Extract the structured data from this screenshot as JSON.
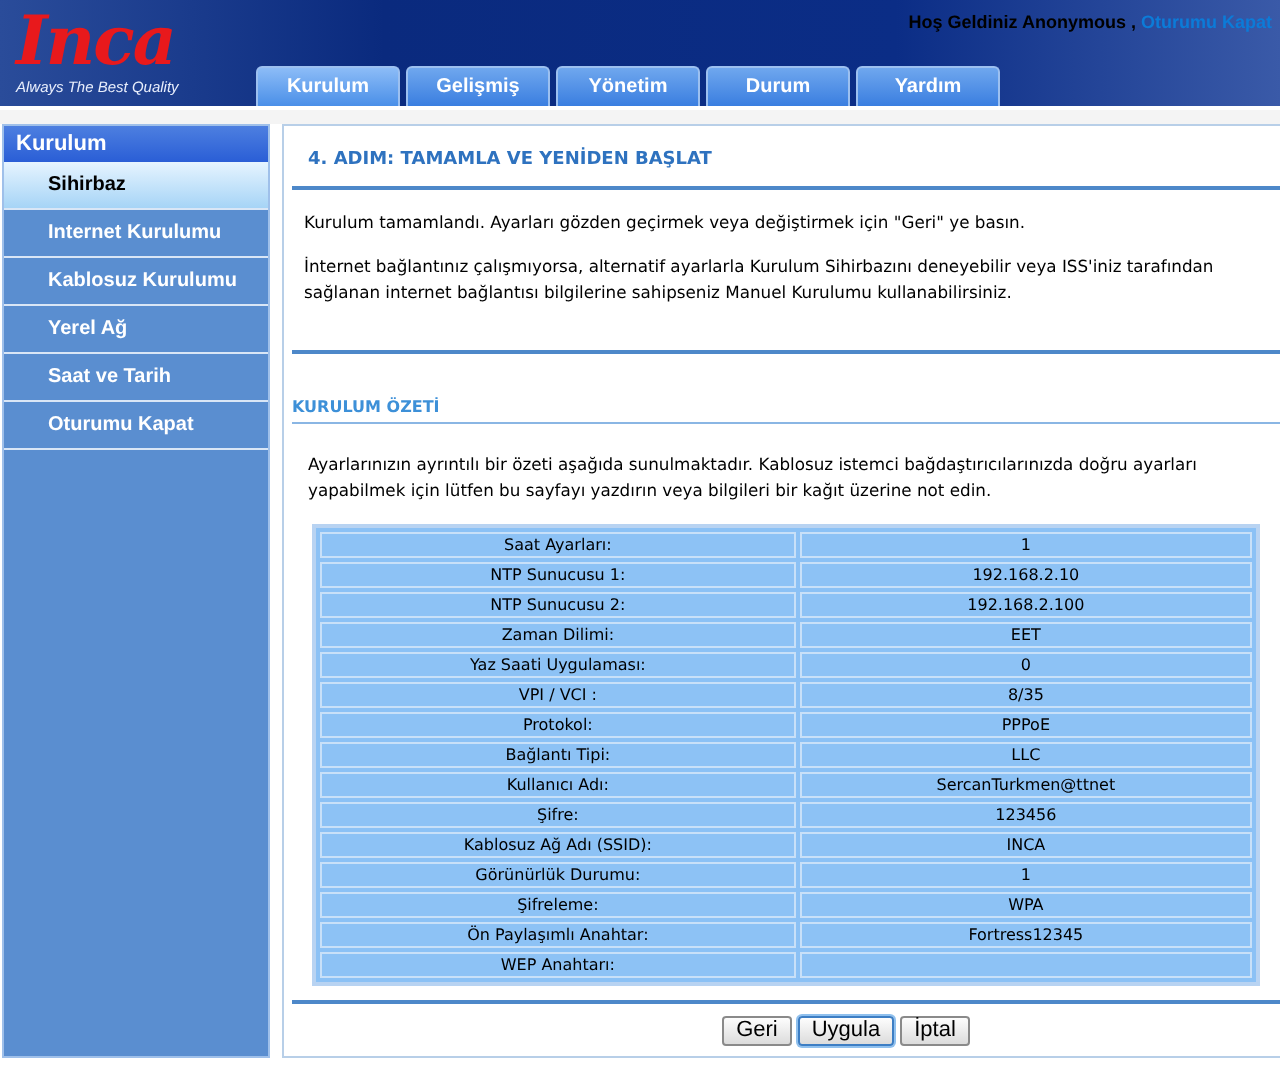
{
  "header": {
    "logo": "Inca",
    "tagline": "Always The Best Quality",
    "welcome": "Hoş Geldiniz Anonymous ,",
    "logout_link": "Oturumu Kapat"
  },
  "tabs": [
    {
      "label": "Kurulum",
      "selected": true
    },
    {
      "label": "Gelişmiş",
      "selected": false
    },
    {
      "label": "Yönetim",
      "selected": false
    },
    {
      "label": "Durum",
      "selected": false
    },
    {
      "label": "Yardım",
      "selected": false
    }
  ],
  "sidebar": {
    "title": "Kurulum",
    "items": [
      {
        "label": "Sihirbaz",
        "selected": true
      },
      {
        "label": "Internet Kurulumu",
        "selected": false
      },
      {
        "label": "Kablosuz Kurulumu",
        "selected": false
      },
      {
        "label": "Yerel Ağ",
        "selected": false
      },
      {
        "label": "Saat ve Tarih",
        "selected": false
      },
      {
        "label": "Oturumu Kapat",
        "selected": false
      }
    ]
  },
  "step_title": "4. ADIM: TAMAMLA VE YENİDEN BAŞLAT",
  "intro": [
    "Kurulum tamamlandı. Ayarları gözden geçirmek veya değiştirmek için \"Geri\" ye basın.",
    "İnternet bağlantınız çalışmıyorsa, alternatif ayarlarla Kurulum Sihirbazını deneyebilir veya ISS'iniz tarafından sağlanan internet bağlantısı bilgilerine sahipseniz Manuel Kurulumu kullanabilirsiniz."
  ],
  "summary_title": "KURULUM ÖZETİ",
  "summary_text": "Ayarlarınızın ayrıntılı bir özeti aşağıda sunulmaktadır. Kablosuz istemci bağdaştırıcılarınızda doğru ayarları yapabilmek için lütfen bu sayfayı yazdırın veya bilgileri bir kağıt üzerine not edin.",
  "table": {
    "rows": [
      {
        "label": "Saat Ayarları:",
        "value": "1"
      },
      {
        "label": "NTP Sunucusu 1:",
        "value": "192.168.2.10"
      },
      {
        "label": "NTP Sunucusu 2:",
        "value": "192.168.2.100"
      },
      {
        "label": "Zaman Dilimi:",
        "value": "EET"
      },
      {
        "label": "Yaz Saati Uygulaması:",
        "value": "0"
      },
      {
        "label": "VPI / VCI :",
        "value": "8/35"
      },
      {
        "label": "Protokol:",
        "value": "PPPoE"
      },
      {
        "label": "Bağlantı Tipi:",
        "value": "LLC"
      },
      {
        "label": "Kullanıcı Adı:",
        "value": "SercanTurkmen@ttnet"
      },
      {
        "label": "Şifre:",
        "value": "123456"
      },
      {
        "label": "Kablosuz Ağ Adı (SSID):",
        "value": "INCA"
      },
      {
        "label": "Görünürlük Durumu:",
        "value": "1"
      },
      {
        "label": "Şifreleme:",
        "value": "WPA"
      },
      {
        "label": "Ön Paylaşımlı Anahtar:",
        "value": "Fortress12345"
      },
      {
        "label": "WEP Anahtarı:"
      }
    ]
  },
  "buttons": [
    {
      "label": "Geri",
      "selected": false
    },
    {
      "label": "Uygula",
      "selected": true
    },
    {
      "label": "İptal",
      "selected": false
    }
  ]
}
